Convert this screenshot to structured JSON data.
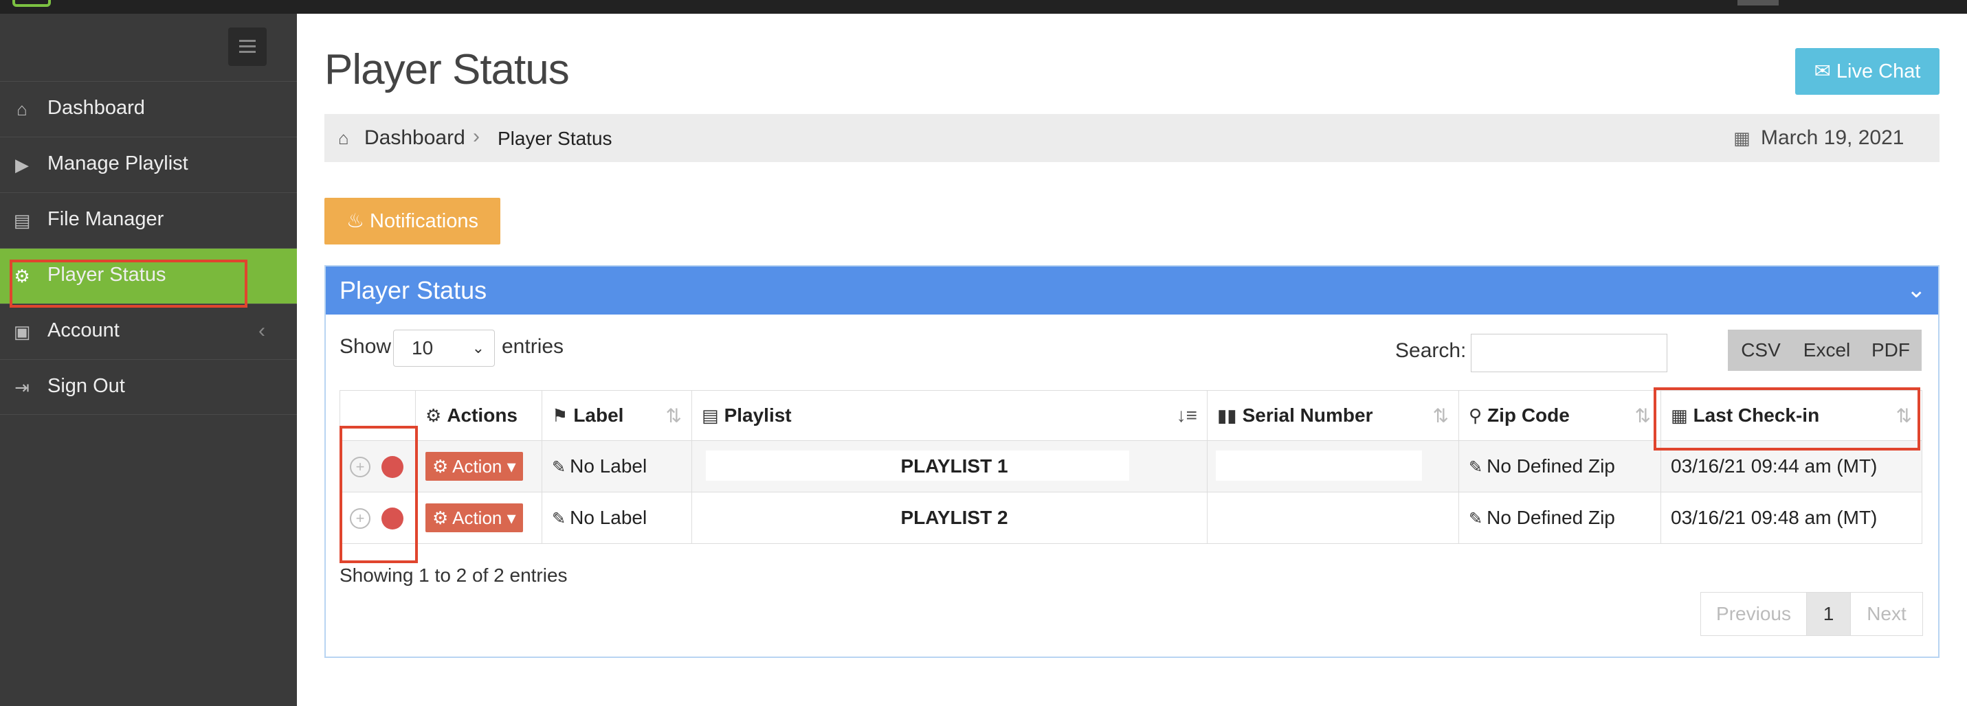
{
  "colors": {
    "sidebar_bg": "#3a3a3a",
    "active_item": "#7ab93c",
    "panel_header": "#5590e8",
    "notifications": "#f0ad4e",
    "live_chat": "#5bc0de",
    "action_button": "#d9674f",
    "status_dot": "#d9534f",
    "highlight_box": "#e0452e"
  },
  "sidebar": {
    "items": [
      {
        "label": "Dashboard",
        "icon": "home-icon"
      },
      {
        "label": "Manage Playlist",
        "icon": "play-icon"
      },
      {
        "label": "File Manager",
        "icon": "folder-icon"
      },
      {
        "label": "Player Status",
        "icon": "gears-icon",
        "active": true
      },
      {
        "label": "Account",
        "icon": "briefcase-icon"
      },
      {
        "label": "Sign Out",
        "icon": "sign-out-icon"
      }
    ]
  },
  "header": {
    "title": "Player Status",
    "live_chat": "Live Chat"
  },
  "breadcrumb": {
    "home": "Dashboard",
    "current": "Player Status",
    "date": "March 19, 2021"
  },
  "notifications_label": "Notifications",
  "panel": {
    "title": "Player Status",
    "show_label": "Show",
    "entries_value": "10",
    "entries_label": "entries",
    "search_label": "Search:",
    "export": [
      "CSV",
      "Excel",
      "PDF"
    ],
    "columns": [
      "Actions",
      "Label",
      "Playlist",
      "Serial Number",
      "Zip Code",
      "Last Check-in"
    ],
    "rows": [
      {
        "action": "Action",
        "label": "No Label",
        "playlist": "PLAYLIST 1",
        "zip": "No Defined Zip",
        "checkin": "03/16/21 09:44 am (MT)"
      },
      {
        "action": "Action",
        "label": "No Label",
        "playlist": "PLAYLIST 2",
        "zip": "No Defined Zip",
        "checkin": "03/16/21 09:48 am (MT)"
      }
    ],
    "info": "Showing 1 to 2 of 2 entries",
    "pager": {
      "previous": "Previous",
      "page": "1",
      "next": "Next"
    }
  }
}
